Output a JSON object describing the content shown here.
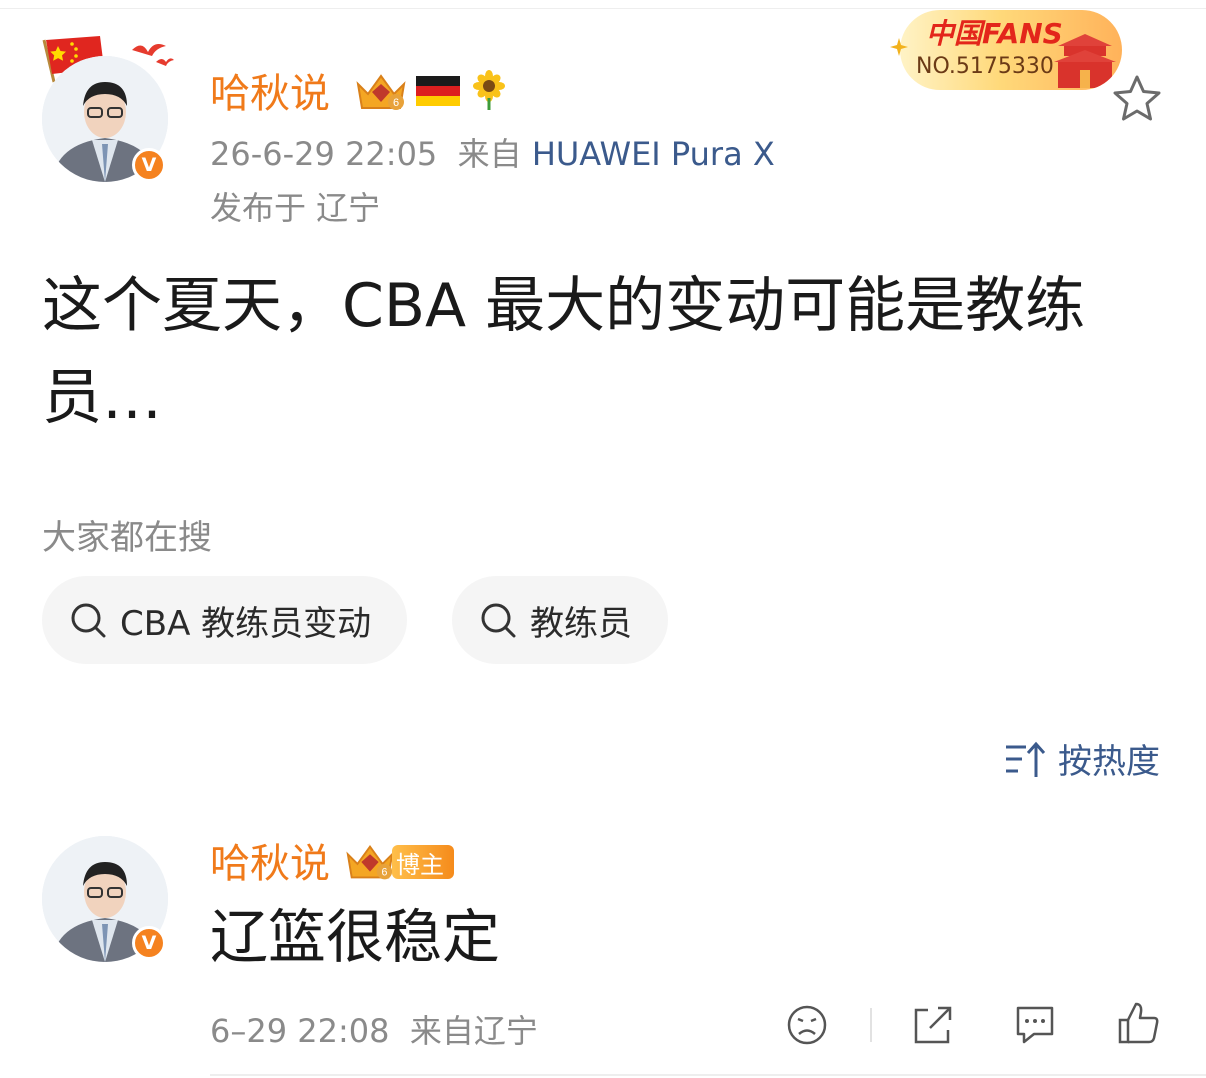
{
  "post": {
    "author": "哈秋说",
    "timestamp": "26-6-29 22:05",
    "source_prefix": "来自",
    "device": "HUAWEI Pura X",
    "location": "发布于 辽宁",
    "text": "这个夏天，CBA 最大的变动可能是教练员…",
    "fans_badge": {
      "title": "中国FANS",
      "number": "NO.5175330"
    }
  },
  "search": {
    "label": "大家都在搜",
    "chips": [
      "CBA 教练员变动",
      "教练员"
    ]
  },
  "sort": {
    "label": "按热度"
  },
  "comment": {
    "author": "哈秋说",
    "tag": "博主",
    "text": "辽篮很稳定",
    "time": "6–29 22:08",
    "source": "来自辽宁"
  },
  "colors": {
    "accent_orange": "#f07a1a",
    "link_blue": "#3b5a8c",
    "meta_gray": "#8a8a8a"
  },
  "icons": [
    "china-flag-icon",
    "crown-level-icon",
    "germany-flag-icon",
    "sunflower-icon",
    "star-icon",
    "search-icon",
    "sort-icon",
    "sad-face-icon",
    "share-icon",
    "comment-icon",
    "like-icon",
    "verified-badge-icon"
  ]
}
